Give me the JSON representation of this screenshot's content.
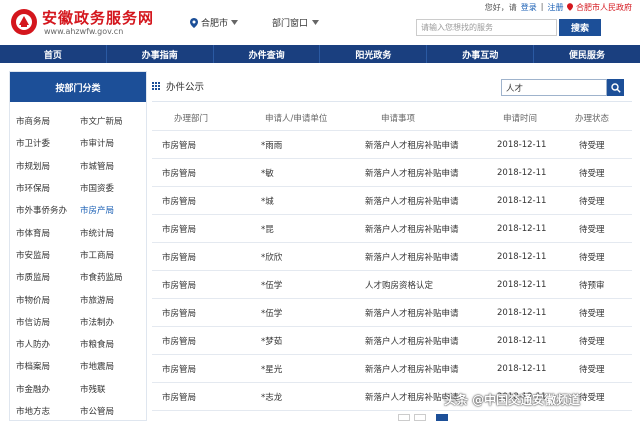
{
  "header": {
    "site_title": "安徽政务服务网",
    "site_url": "www.ahzwfw.gov.cn",
    "city": "合肥市",
    "dept_label": "部门窗口",
    "greeting": "您好，请",
    "login": "登录",
    "separator": "|",
    "register": "注册",
    "gov_link": "合肥市人民政府",
    "search_placeholder": "请输入您想找的服务",
    "search_button": "搜索"
  },
  "nav": {
    "items": [
      {
        "label": "首页"
      },
      {
        "label": "办事指南"
      },
      {
        "label": "办件查询"
      },
      {
        "label": "阳光政务"
      },
      {
        "label": "办事互动"
      },
      {
        "label": "便民服务"
      }
    ]
  },
  "sidebar": {
    "title": "按部门分类",
    "rows": [
      {
        "left": "市商务局",
        "right": "市文广新局"
      },
      {
        "left": "市卫计委",
        "right": "市审计局"
      },
      {
        "left": "市规划局",
        "right": "市城管局"
      },
      {
        "left": "市环保局",
        "right": "市国资委"
      },
      {
        "left": "市外事侨务办",
        "right": "市房产局"
      },
      {
        "left": "市体育局",
        "right": "市统计局"
      },
      {
        "left": "市安监局",
        "right": "市工商局"
      },
      {
        "left": "市质监局",
        "right": "市食药监局"
      },
      {
        "left": "市物价局",
        "right": "市旅游局"
      },
      {
        "left": "市信访局",
        "right": "市法制办"
      },
      {
        "left": "市人防办",
        "right": "市粮食局"
      },
      {
        "left": "市档案局",
        "right": "市地震局"
      },
      {
        "left": "市金融办",
        "right": "市残联"
      },
      {
        "left": "市地方志",
        "right": "市公管局"
      }
    ]
  },
  "main": {
    "title": "办件公示",
    "filter_value": "人才",
    "columns": [
      "办理部门",
      "申请人/申请单位",
      "申请事项",
      "申请时间",
      "办理状态"
    ],
    "rows": [
      {
        "dept": "市房管局",
        "applicant": "*雨雨",
        "item": "新落户人才租房补贴申请",
        "date": "2018-12-11",
        "status": "待受理"
      },
      {
        "dept": "市房管局",
        "applicant": "*敏",
        "item": "新落户人才租房补贴申请",
        "date": "2018-12-11",
        "status": "待受理"
      },
      {
        "dept": "市房管局",
        "applicant": "*城",
        "item": "新落户人才租房补贴申请",
        "date": "2018-12-11",
        "status": "待受理"
      },
      {
        "dept": "市房管局",
        "applicant": "*昆",
        "item": "新落户人才租房补贴申请",
        "date": "2018-12-11",
        "status": "待受理"
      },
      {
        "dept": "市房管局",
        "applicant": "*欣欣",
        "item": "新落户人才租房补贴申请",
        "date": "2018-12-11",
        "status": "待受理"
      },
      {
        "dept": "市房管局",
        "applicant": "*伍学",
        "item": "人才购房资格认定",
        "date": "2018-12-11",
        "status": "待预审"
      },
      {
        "dept": "市房管局",
        "applicant": "*伍学",
        "item": "新落户人才租房补贴申请",
        "date": "2018-12-11",
        "status": "待受理"
      },
      {
        "dept": "市房管局",
        "applicant": "*梦茹",
        "item": "新落户人才租房补贴申请",
        "date": "2018-12-11",
        "status": "待受理"
      },
      {
        "dept": "市房管局",
        "applicant": "*星光",
        "item": "新落户人才租房补贴申请",
        "date": "2018-12-11",
        "status": "待受理"
      },
      {
        "dept": "市房管局",
        "applicant": "*志龙",
        "item": "新落户人才租房补贴申请",
        "date": "2018-12-11",
        "status": "待受理"
      }
    ]
  },
  "watermark": "头条 @中国交通安徽频道",
  "colors": {
    "brand_red": "#d4161d",
    "nav_blue": "#1a3f7f",
    "accent_blue": "#1c4f98",
    "link_blue": "#1a5fb4"
  }
}
